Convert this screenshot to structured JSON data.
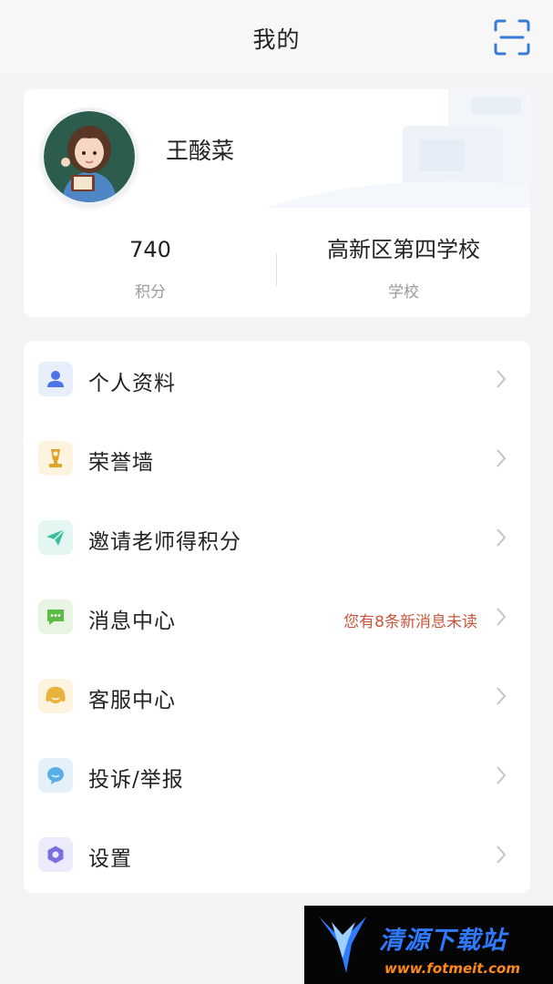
{
  "header": {
    "title": "我的"
  },
  "profile": {
    "name": "王酸菜",
    "stats": [
      {
        "value": "740",
        "label": "积分"
      },
      {
        "value": "高新区第四学校",
        "label": "学校"
      }
    ]
  },
  "menu": {
    "items": [
      {
        "label": "个人资料",
        "icon": "person-icon",
        "color": "#4a74e8",
        "bg": "#e8eefc"
      },
      {
        "label": "荣誉墙",
        "icon": "trophy-icon",
        "color": "#e0a32a",
        "bg": "#fdf3df"
      },
      {
        "label": "邀请老师得积分",
        "icon": "paper-plane-icon",
        "color": "#3cbf9f",
        "bg": "#e3f6f1"
      },
      {
        "label": "消息中心",
        "icon": "chat-bubble-icon",
        "color": "#5cba47",
        "bg": "#e8f5e3",
        "extra": "您有8条新消息未读"
      },
      {
        "label": "客服中心",
        "icon": "headset-icon",
        "color": "#e8b33b",
        "bg": "#fdf3df"
      },
      {
        "label": "投诉/举报",
        "icon": "speech-bubble-icon",
        "color": "#5aaee8",
        "bg": "#e4f1fb"
      },
      {
        "label": "设置",
        "icon": "settings-hex-icon",
        "color": "#7b6fe0",
        "bg": "#ecebfb"
      }
    ]
  },
  "colors": {
    "accent": "#3a7bd5",
    "notice": "#c8553d"
  },
  "watermark": {
    "title": "清源下载站",
    "url": "www.fotmeit.com"
  }
}
